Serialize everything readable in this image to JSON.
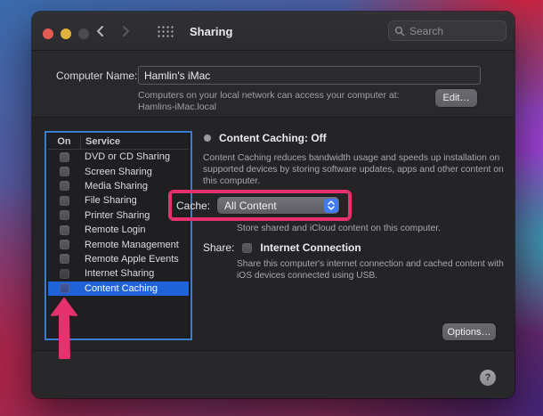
{
  "titlebar": {
    "title": "Sharing",
    "search_placeholder": "Search"
  },
  "computer_name": {
    "label": "Computer Name:",
    "value": "Hamlin's iMac",
    "description_line1": "Computers on your local network can access your computer at:",
    "description_line2": "Hamlins-iMac.local",
    "edit_button": "Edit…"
  },
  "services": {
    "columns": {
      "on": "On",
      "service": "Service"
    },
    "items": [
      "DVD or CD Sharing",
      "Screen Sharing",
      "Media Sharing",
      "File Sharing",
      "Printer Sharing",
      "Remote Login",
      "Remote Management",
      "Remote Apple Events",
      "Internet Sharing",
      "Content Caching"
    ],
    "selected_item": "Content Caching"
  },
  "content": {
    "status_heading": "Content Caching: Off",
    "description": "Content Caching reduces bandwidth usage and speeds up installation on supported devices by storing software updates, apps and other content on this computer.",
    "cache_label": "Cache:",
    "cache_value": "All Content",
    "cache_note": "Store shared and iCloud content on this computer.",
    "share_label": "Share:",
    "share_option": "Internet Connection",
    "share_description": "Share this computer's internet connection and cached content with iOS devices connected using USB.",
    "options_button": "Options…"
  },
  "footer": {
    "help_label": "?"
  },
  "annotations": {
    "highlight_color": "#e6316e",
    "list_border_color": "#3a7cd2",
    "selected_row_color": "#1f63d6"
  }
}
